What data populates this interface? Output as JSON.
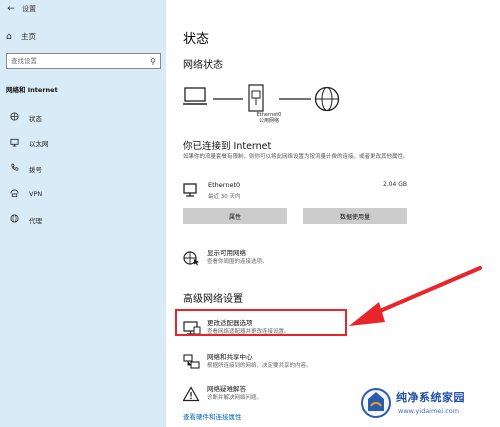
{
  "window": {
    "title": "设置"
  },
  "sidebar": {
    "home": "主页",
    "search_placeholder": "查找设置",
    "section": "网络和 Internet",
    "items": [
      {
        "label": "状态",
        "icon": "globe-icon"
      },
      {
        "label": "以太网",
        "icon": "monitor-ethernet-icon"
      },
      {
        "label": "拨号",
        "icon": "phone-icon"
      },
      {
        "label": "VPN",
        "icon": "vpn-icon"
      },
      {
        "label": "代理",
        "icon": "proxy-globe-icon"
      }
    ]
  },
  "main": {
    "title": "状态",
    "network_status": "网络状态",
    "diagram": {
      "adapter_name": "Ethernet0",
      "network_type": "公用网络"
    },
    "connected_title": "你已连接到 Internet",
    "connected_desc": "如果你的流量套餐有限制，则你可以将此网络设置为按流量计费的连接，或者更改其他属性。",
    "ethernet": {
      "name": "Ethernet0",
      "period": "最近 30 天内",
      "usage": "2.04 GB"
    },
    "buttons": {
      "properties": "属性",
      "data_usage": "数据使用量"
    },
    "show_networks": {
      "title": "显示可用网络",
      "desc": "查看你周围的连接选项。"
    },
    "advanced_title": "高级网络设置",
    "adapter_options": {
      "title": "更改适配器选项",
      "desc": "查看网络适配器并更改连接设置。"
    },
    "sharing_center": {
      "title": "网络和共享中心",
      "desc": "根据所连接到的网络，决定要共享的内容。"
    },
    "troubleshooter": {
      "title": "网络疑难解答",
      "desc": "诊断并解决网络问题。"
    },
    "hardware_link": "查看硬件和连接属性"
  },
  "watermark": {
    "title": "纯净系统家园",
    "url": "www.yidaimei.com"
  },
  "colors": {
    "sidebar_bg": "#d9ebf7",
    "button_bg": "#cccccc",
    "link": "#0067c0",
    "annotation": "#e8252a"
  }
}
